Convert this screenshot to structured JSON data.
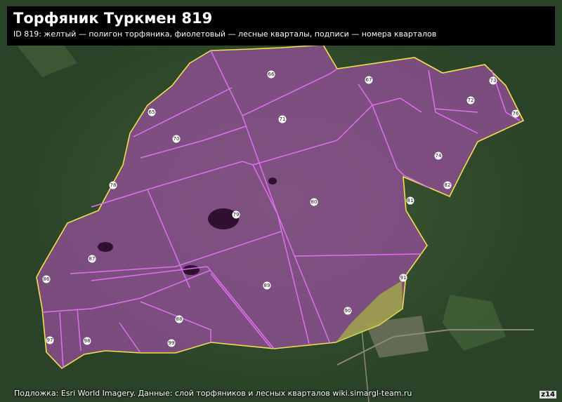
{
  "header": {
    "title": "Торфяник Туркмен 819",
    "subtitle": "ID 819: желтый — полигон торфяника, фиолетовый — лесные кварталы, подписи — номера кварталов"
  },
  "attribution": "Подложка: Esri World Imagery. Данные: слой торфяников и лесных кварталов wiki.simargl-team.ru",
  "zoom_label": "z14",
  "colors": {
    "peat_outline": "#f2e24a",
    "quarter_lines": "#e070f0",
    "peat_fill": "#9a4fa0",
    "forest": "#2f4a2c"
  },
  "quarters": [
    "65",
    "66",
    "67",
    "70",
    "71",
    "72",
    "73",
    "74",
    "76",
    "78",
    "79",
    "80",
    "81",
    "82",
    "86",
    "87",
    "88",
    "89",
    "90",
    "91",
    "97",
    "98",
    "99"
  ]
}
